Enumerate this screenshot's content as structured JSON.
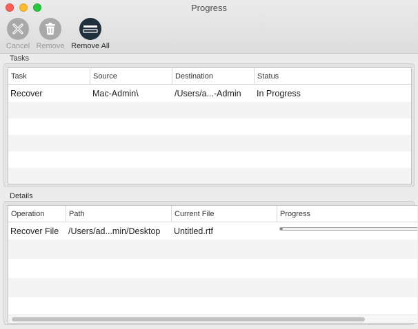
{
  "window": {
    "title": "Progress"
  },
  "toolbar": {
    "cancel_label": "Cancel",
    "remove_label": "Remove",
    "remove_all_label": "Remove All"
  },
  "tasks": {
    "section_label": "Tasks",
    "columns": [
      "Task",
      "Source",
      "Destination",
      "Status"
    ],
    "rows": [
      {
        "task": "Recover",
        "source": "Mac-Admin\\",
        "destination": "/Users/a...-Admin",
        "status": "In Progress"
      }
    ]
  },
  "details": {
    "section_label": "Details",
    "columns": [
      "Operation",
      "Path",
      "Current File",
      "Progress"
    ],
    "rows": [
      {
        "operation": "Recover File",
        "path": "/Users/ad...min/Desktop",
        "current_file": "Untitled.rtf",
        "progress": 0.01
      }
    ]
  },
  "colors": {
    "close": "#fe5f57",
    "minimize": "#febc2e",
    "maximize": "#28c840",
    "toolbar_active": "#20313d",
    "toolbar_disabled": "#a9a9a9"
  }
}
